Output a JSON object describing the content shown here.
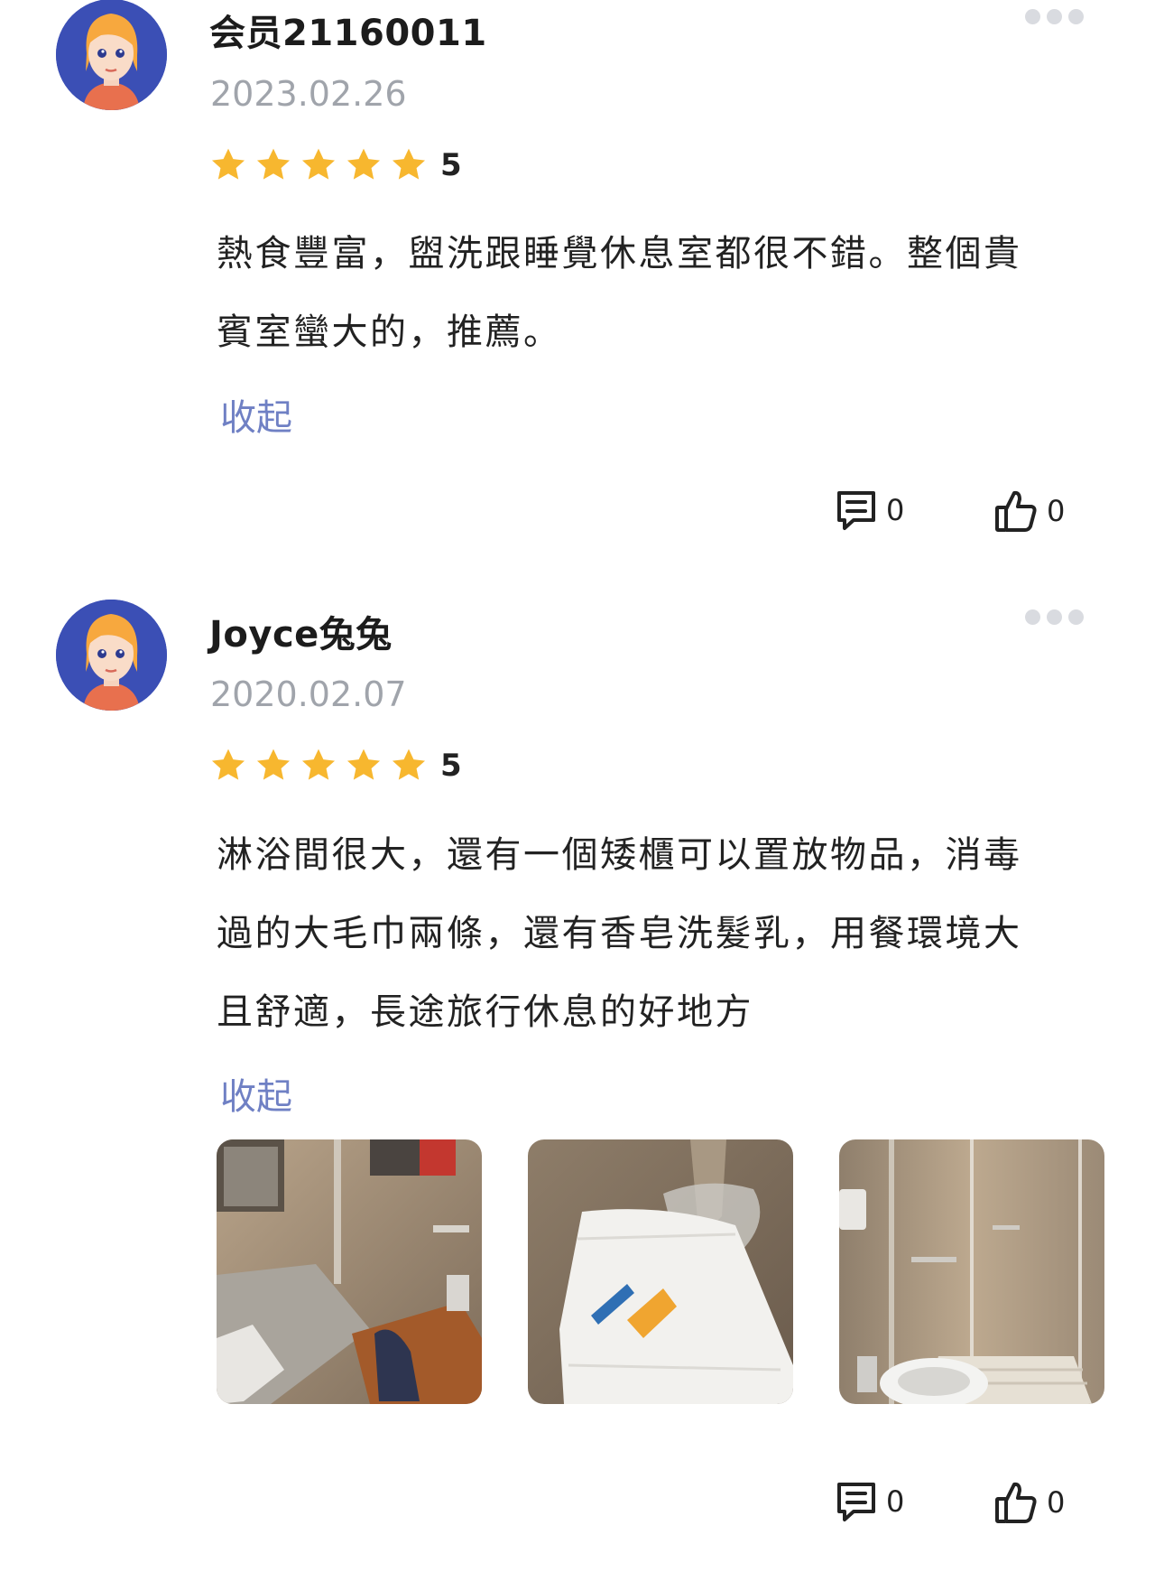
{
  "reviews": [
    {
      "username": "会员21160011",
      "date": "2023.02.26",
      "rating": "5",
      "text_lines": [
        "熱食豐富，盥洗跟睡覺休息室都很不錯。整個貴",
        "賓室蠻大的，推薦。"
      ],
      "collapse_label": "收起",
      "comment_count": "0",
      "like_count": "0",
      "photos": []
    },
    {
      "username": "Joyce兔兔",
      "date": "2020.02.07",
      "rating": "5",
      "text_lines": [
        "淋浴間很大，還有一個矮櫃可以置放物品，消毒",
        "過的大毛巾兩條，還有香皂洗髮乳，用餐環境大",
        "且舒適，長途旅行休息的好地方"
      ],
      "collapse_label": "收起",
      "comment_count": "0",
      "like_count": "0",
      "photos": [
        "bathroom-sink-photo",
        "towel-and-toiletries-photo",
        "shower-and-toilet-photo"
      ]
    }
  ],
  "colors": {
    "star": "#f7b72f",
    "collapse_link": "#6f80c4",
    "date": "#a0a4ab",
    "avatar_bg": "#3b4fb5"
  },
  "icons": {
    "more": "more-dots-icon",
    "comment": "comment-icon",
    "like": "thumbs-up-icon",
    "star": "star-icon"
  }
}
